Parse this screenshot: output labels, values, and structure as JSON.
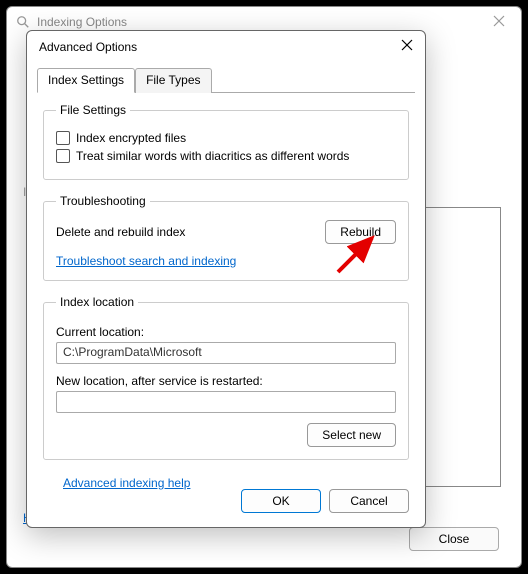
{
  "outer": {
    "title": "Indexing Options",
    "trunc_label": "I",
    "hlink": "H",
    "close_btn": "Close"
  },
  "inner": {
    "title": "Advanced Options",
    "tabs": {
      "settings": "Index Settings",
      "filetypes": "File Types"
    },
    "filesettings": {
      "legend": "File Settings",
      "opt_encrypted": "Index encrypted files",
      "opt_diacritics": "Treat similar words with diacritics as different words"
    },
    "troubleshoot": {
      "legend": "Troubleshooting",
      "rebuild_label": "Delete and rebuild index",
      "rebuild_btn": "Rebuild",
      "link": "Troubleshoot search and indexing"
    },
    "location": {
      "legend": "Index location",
      "current_lbl": "Current location:",
      "current_val": "C:\\ProgramData\\Microsoft",
      "new_lbl": "New location, after service is restarted:",
      "new_val": "",
      "select_btn": "Select new"
    },
    "help_link": "Advanced indexing help",
    "ok": "OK",
    "cancel": "Cancel"
  }
}
